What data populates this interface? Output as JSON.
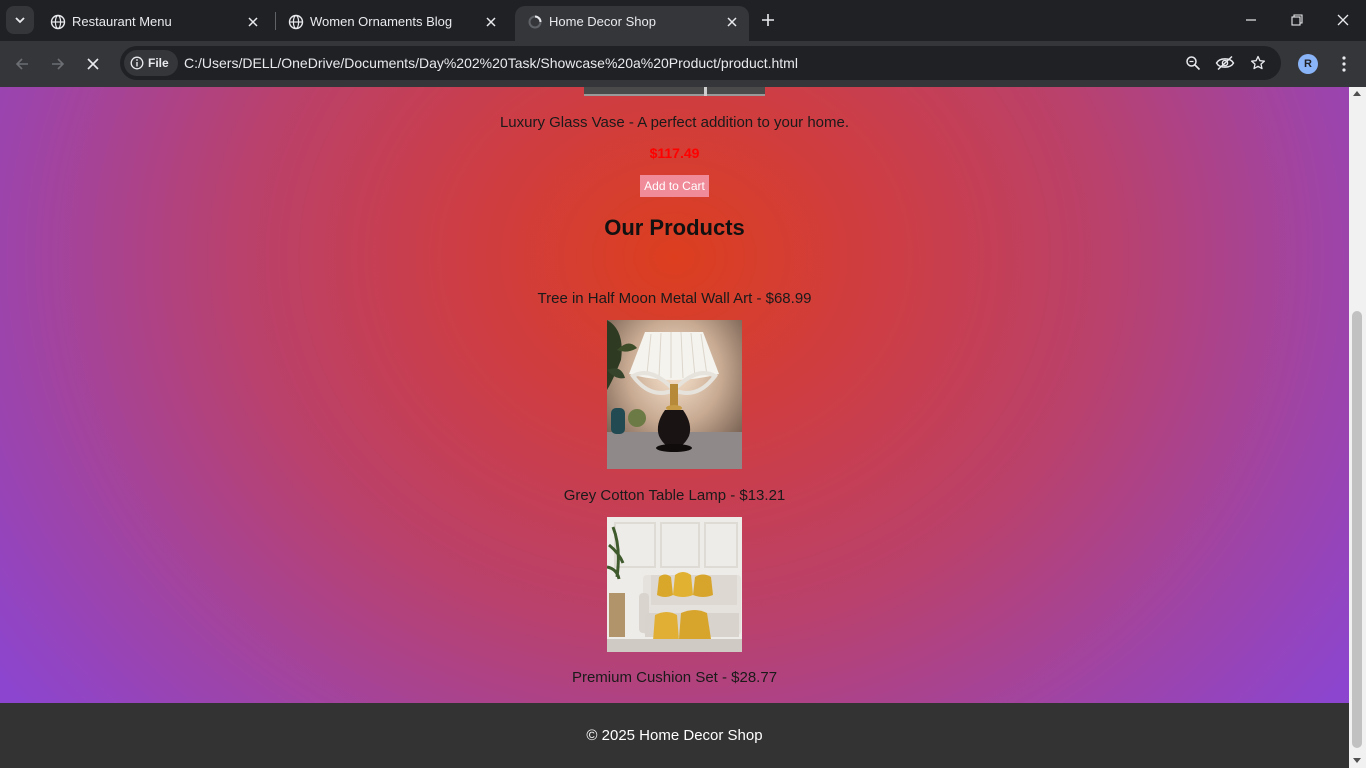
{
  "browser": {
    "tabs": [
      {
        "title": "Restaurant Menu",
        "icon": "globe-icon",
        "active": false
      },
      {
        "title": "Women Ornaments Blog",
        "icon": "globe-icon",
        "active": false
      },
      {
        "title": "Home Decor Shop",
        "icon": "loading-icon",
        "active": true
      }
    ],
    "address": {
      "chip_label": "File",
      "url": "C:/Users/DELL/OneDrive/Documents/Day%202%20Task/Showcase%20a%20Product/product.html"
    },
    "profile_initial": "R",
    "colors": {
      "frame": "#202124",
      "toolbar": "#35363a",
      "text": "#e8eaed"
    }
  },
  "page": {
    "featured": {
      "description": "Luxury Glass Vase - A perfect addition to your home.",
      "price": "$117.49",
      "button_label": "Add to Cart"
    },
    "section_title": "Our Products",
    "products": [
      {
        "label": "Tree in Half Moon Metal Wall Art - $68.99"
      },
      {
        "label": "Grey Cotton Table Lamp - $13.21"
      },
      {
        "label": "Premium Cushion Set - $28.77"
      }
    ],
    "footer": "© 2025 Home Decor Shop",
    "colors": {
      "price": "#ff0000",
      "button": "#f08c9a",
      "footer_bg": "#333333",
      "gradient_center": "#dc3e1e",
      "gradient_edge": "#8c45cf"
    }
  }
}
